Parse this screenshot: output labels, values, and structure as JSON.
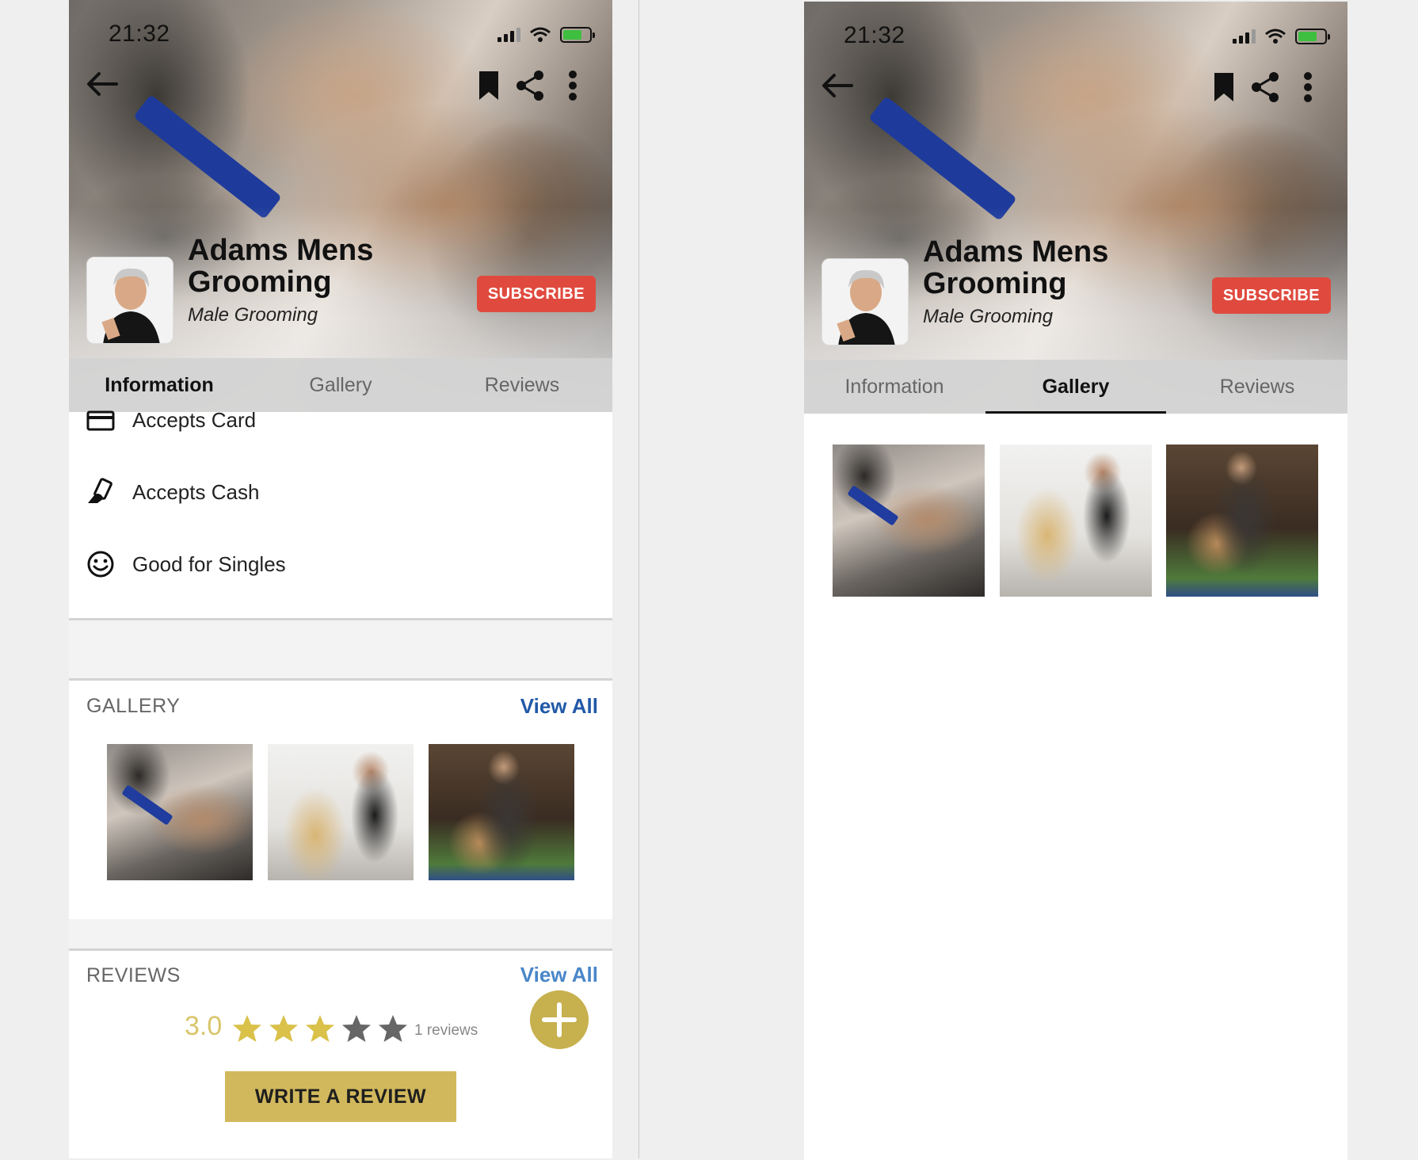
{
  "status": {
    "time": "21:32"
  },
  "business": {
    "name_line1": "Adams Mens",
    "name_line2": "Grooming",
    "category": "Male Grooming",
    "subscribe_label": "SUBSCRIBE"
  },
  "tabs": [
    {
      "label": "Information"
    },
    {
      "label": "Gallery"
    },
    {
      "label": "Reviews"
    }
  ],
  "left_screen": {
    "active_tab": "Information"
  },
  "right_screen": {
    "active_tab": "Gallery"
  },
  "info": {
    "items": [
      {
        "label": "Accepts Card",
        "icon": "credit-card-icon"
      },
      {
        "label": "Accepts Cash",
        "icon": "cash-icon"
      },
      {
        "label": "Good for Singles",
        "icon": "smiley-icon"
      }
    ]
  },
  "gallery": {
    "title": "GALLERY",
    "view_all": "View All",
    "images": [
      "barber-trimming-beard-photo",
      "stylist-blow-drying-hair-photo",
      "stylist-cutting-hair-photo"
    ]
  },
  "reviews": {
    "title": "REVIEWS",
    "view_all": "View All",
    "rating": "3.0",
    "stars_filled": 3,
    "stars_total": 5,
    "count_label": "1 reviews",
    "write_label": "WRITE A REVIEW"
  },
  "colors": {
    "subscribe": "#e04a3e",
    "view_all": "#2159a8",
    "gold": "#d2b85c",
    "star_filled": "#d9c14a",
    "star_empty": "#666666"
  }
}
